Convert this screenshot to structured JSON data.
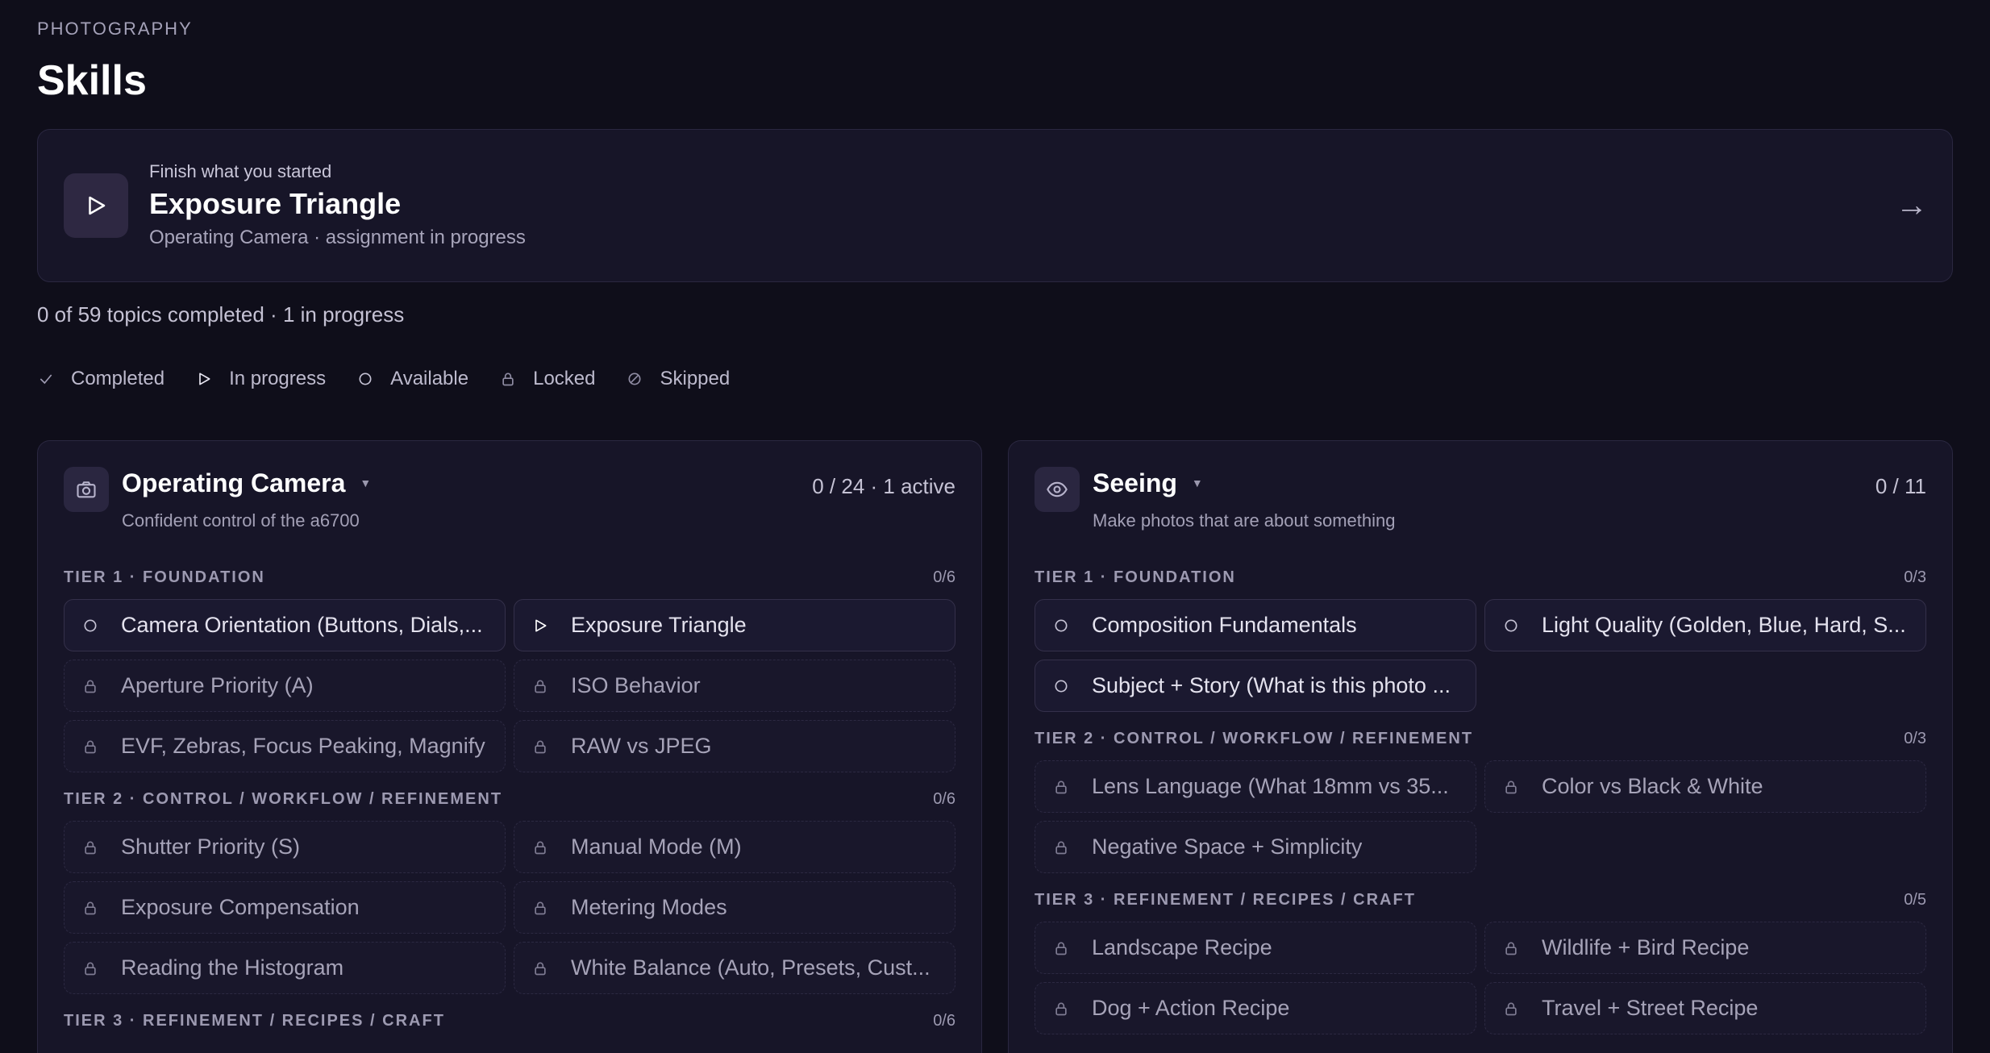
{
  "header": {
    "eyebrow": "PHOTOGRAPHY",
    "title": "Skills"
  },
  "resume": {
    "kicker": "Finish what you started",
    "title": "Exposure Triangle",
    "subtitle": "Operating Camera · assignment in progress",
    "arrow": "→"
  },
  "summary": "0 of 59 topics completed · 1 in progress",
  "legend": {
    "completed": "Completed",
    "in_progress": "In progress",
    "available": "Available",
    "locked": "Locked",
    "skipped": "Skipped"
  },
  "panels": [
    {
      "icon": "camera-icon",
      "title": "Operating Camera",
      "caret": "▼",
      "desc": "Confident control of the a6700",
      "count": "0 / 24 · 1 active",
      "tiers": [
        {
          "label": "TIER 1 · FOUNDATION",
          "count": "0/6",
          "topics": [
            {
              "label": "Camera Orientation (Buttons, Dials,...",
              "status": "available"
            },
            {
              "label": "Exposure Triangle",
              "status": "inprogress"
            },
            {
              "label": "Aperture Priority (A)",
              "status": "locked"
            },
            {
              "label": "ISO Behavior",
              "status": "locked"
            },
            {
              "label": "EVF, Zebras, Focus Peaking, Magnify",
              "status": "locked"
            },
            {
              "label": "RAW vs JPEG",
              "status": "locked"
            }
          ]
        },
        {
          "label": "TIER 2 · CONTROL / WORKFLOW / REFINEMENT",
          "count": "0/6",
          "topics": [
            {
              "label": "Shutter Priority (S)",
              "status": "locked"
            },
            {
              "label": "Manual Mode (M)",
              "status": "locked"
            },
            {
              "label": "Exposure Compensation",
              "status": "locked"
            },
            {
              "label": "Metering Modes",
              "status": "locked"
            },
            {
              "label": "Reading the Histogram",
              "status": "locked"
            },
            {
              "label": "White Balance (Auto, Presets, Cust...",
              "status": "locked"
            }
          ]
        },
        {
          "label": "TIER 3 · REFINEMENT / RECIPES / CRAFT",
          "count": "0/6",
          "topics": []
        }
      ]
    },
    {
      "icon": "eye-icon",
      "title": "Seeing",
      "caret": "▼",
      "desc": "Make photos that are about something",
      "count": "0 / 11",
      "tiers": [
        {
          "label": "TIER 1 · FOUNDATION",
          "count": "0/3",
          "topics": [
            {
              "label": "Composition Fundamentals",
              "status": "available"
            },
            {
              "label": "Light Quality (Golden, Blue, Hard, S...",
              "status": "available"
            },
            {
              "label": "Subject + Story (What is this photo ...",
              "status": "available"
            }
          ]
        },
        {
          "label": "TIER 2 · CONTROL / WORKFLOW / REFINEMENT",
          "count": "0/3",
          "topics": [
            {
              "label": "Lens Language (What 18mm vs 35...",
              "status": "locked"
            },
            {
              "label": "Color vs Black & White",
              "status": "locked"
            },
            {
              "label": "Negative Space + Simplicity",
              "status": "locked"
            }
          ]
        },
        {
          "label": "TIER 3 · REFINEMENT / RECIPES / CRAFT",
          "count": "0/5",
          "topics": [
            {
              "label": "Landscape Recipe",
              "status": "locked"
            },
            {
              "label": "Wildlife + Bird Recipe",
              "status": "locked"
            },
            {
              "label": "Dog + Action Recipe",
              "status": "locked"
            },
            {
              "label": "Travel + Street Recipe",
              "status": "locked"
            }
          ]
        }
      ]
    }
  ]
}
